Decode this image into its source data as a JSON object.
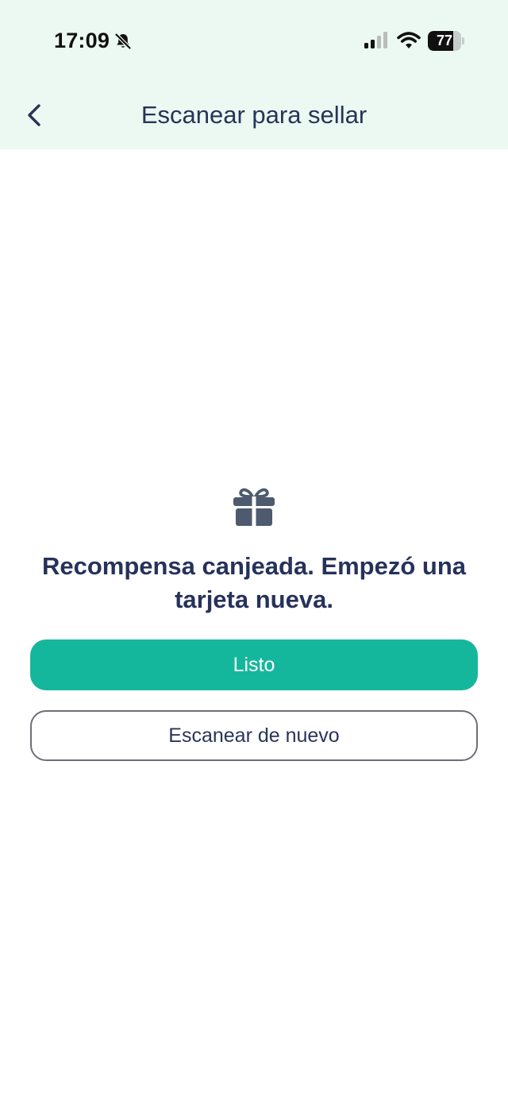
{
  "status_bar": {
    "time": "17:09",
    "battery_level": "77",
    "icons": [
      "bell-slash-icon",
      "cellular-signal-icon",
      "wifi-icon",
      "battery-icon"
    ]
  },
  "nav": {
    "back_icon": "chevron-left-icon",
    "title": "Escanear para sellar"
  },
  "content": {
    "icon": "gift-icon",
    "message": "Recompensa canjeada. Empezó una tarjeta nueva.",
    "primary_button_label": "Listo",
    "secondary_button_label": "Escanear de nuevo"
  },
  "colors": {
    "header_background": "#ecf9f2",
    "accent": "#15b79c",
    "text_dark": "#26325a"
  }
}
